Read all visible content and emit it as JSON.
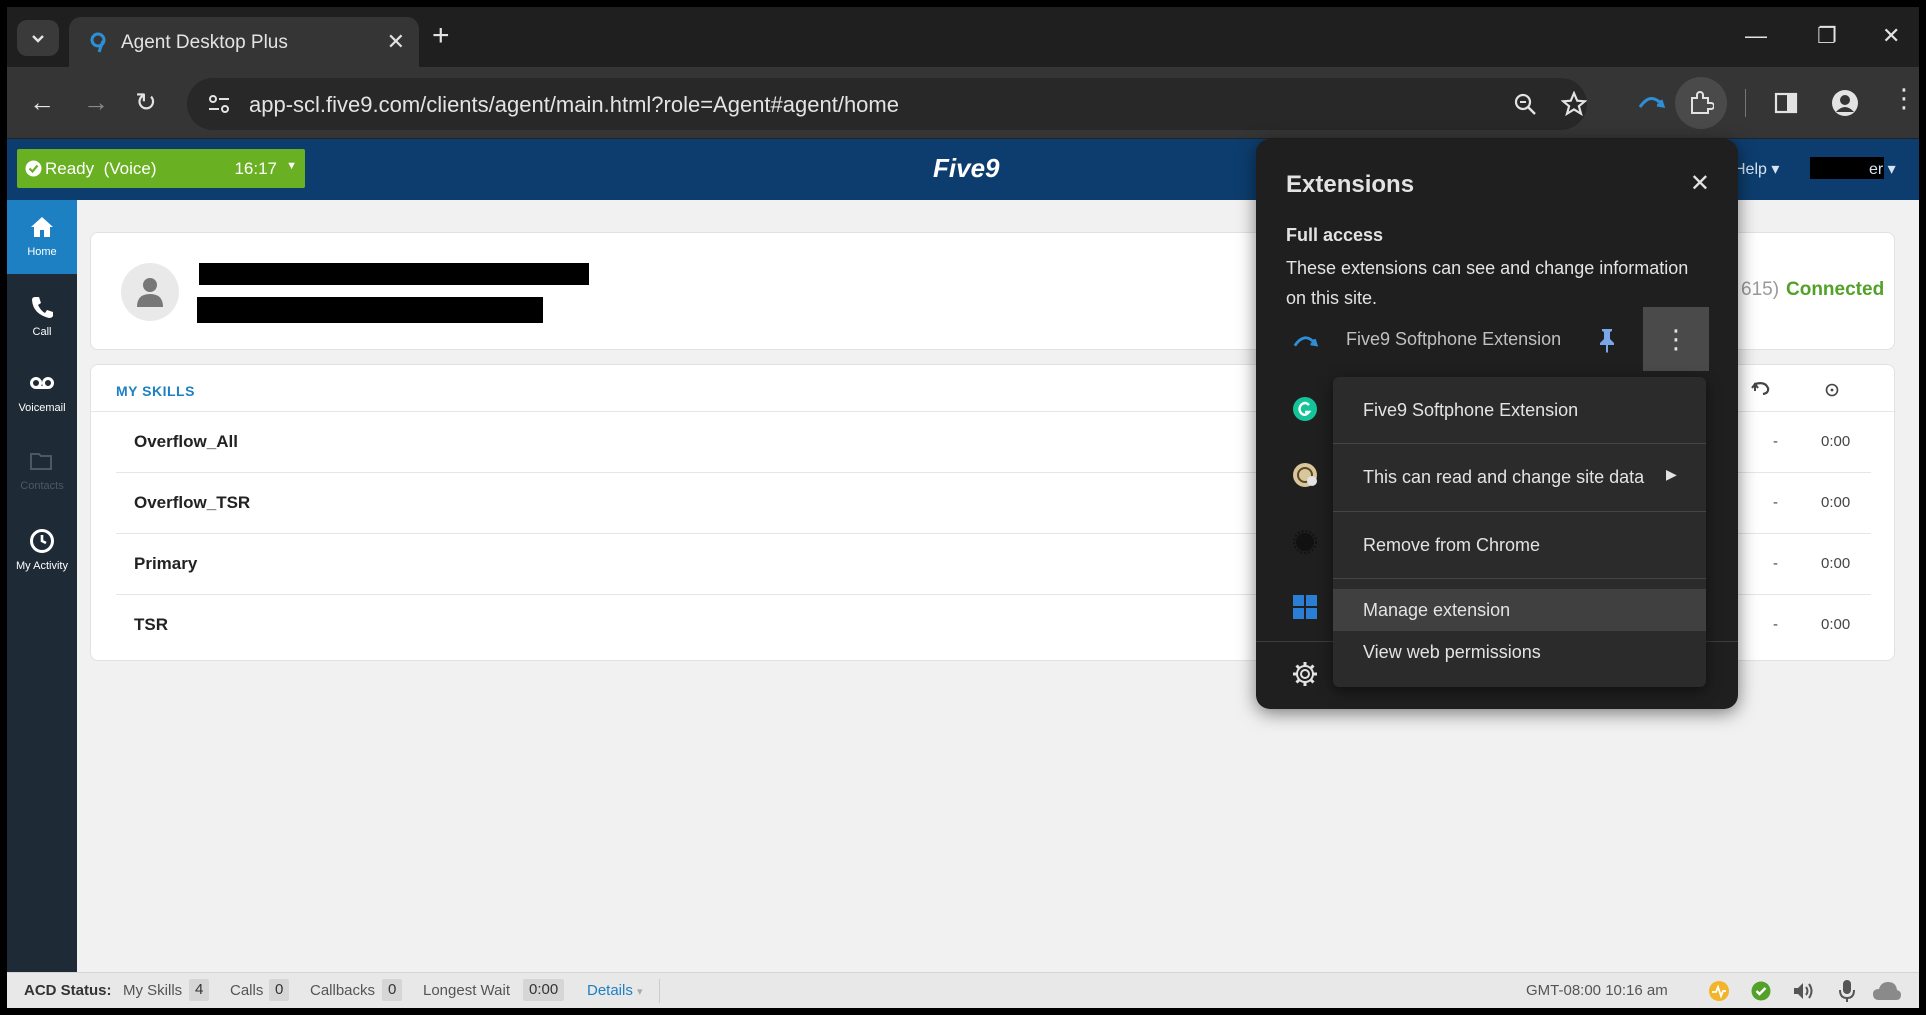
{
  "browser": {
    "tab_title": "Agent Desktop Plus",
    "url": "app-scl.five9.com/clients/agent/main.html?role=Agent#agent/home"
  },
  "app": {
    "status_label": "Ready  (Voice)",
    "status_time": "16:17",
    "logo": "Five9",
    "help_label": "Help",
    "user_suffix": "er",
    "extension_partial": "615)",
    "connection_status": "Connected"
  },
  "sidebar": {
    "items": [
      {
        "label": "Home",
        "icon": "home-icon"
      },
      {
        "label": "Call",
        "icon": "phone-icon"
      },
      {
        "label": "Voicemail",
        "icon": "voicemail-icon"
      },
      {
        "label": "Contacts",
        "icon": "folder-icon"
      },
      {
        "label": "My Activity",
        "icon": "clock-icon"
      }
    ]
  },
  "skills": {
    "header": "MY SKILLS",
    "rows": [
      {
        "name": "Overflow_All",
        "dash": "-",
        "time": "0:00"
      },
      {
        "name": "Overflow_TSR",
        "dash": "-",
        "time": "0:00"
      },
      {
        "name": "Primary",
        "dash": "-",
        "time": "0:00"
      },
      {
        "name": "TSR",
        "dash": "-",
        "time": "0:00"
      }
    ]
  },
  "statusbar": {
    "acd_label": "ACD Status:",
    "my_skills_label": "My Skills",
    "my_skills_count": "4",
    "calls_label": "Calls",
    "calls_count": "0",
    "callbacks_label": "Callbacks",
    "callbacks_count": "0",
    "longest_wait_label": "Longest Wait",
    "longest_wait_value": "0:00",
    "details_label": "Details",
    "time": "GMT-08:00 10:16 am"
  },
  "extensions_popup": {
    "title": "Extensions",
    "section_title": "Full access",
    "description": "These extensions can see and change information on this site.",
    "extension_name": "Five9 Softphone Extension"
  },
  "context_menu": {
    "items": [
      "Five9 Softphone Extension",
      "This can read and change site data",
      "Remove from Chrome",
      "Manage extension",
      "View web permissions"
    ]
  }
}
